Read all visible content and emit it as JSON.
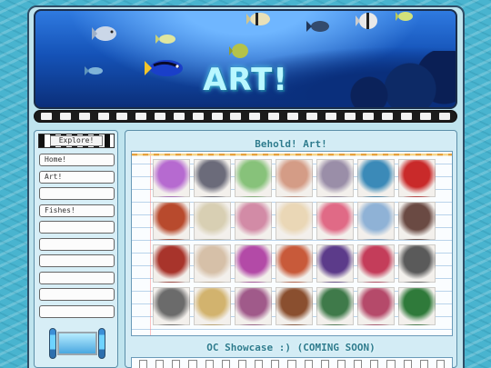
{
  "banner": {
    "title": "ART!"
  },
  "sidebar": {
    "header": "Explore!",
    "items": [
      {
        "label": "Home!"
      },
      {
        "label": "Art!"
      },
      {
        "label": ""
      },
      {
        "label": "Fishes!"
      },
      {
        "label": ""
      },
      {
        "label": ""
      },
      {
        "label": ""
      },
      {
        "label": ""
      },
      {
        "label": ""
      },
      {
        "label": ""
      }
    ]
  },
  "main": {
    "gallery_title": "Behold! Art!",
    "showcase_title": "OC Showcase :) (COMING SOON)"
  },
  "gallery": {
    "thumbnails": [
      "#b66ad0",
      "#6b6b7a",
      "#87c27a",
      "#d49c86",
      "#9a8ea8",
      "#3b8ab8",
      "#c92a2a",
      "#b84a2d",
      "#d8cfb3",
      "#d28ba6",
      "#ead7b6",
      "#e06a86",
      "#8fb2d6",
      "#6a4a43",
      "#a8342b",
      "#d6c0a8",
      "#b34aa7",
      "#c85a3a",
      "#5c3b8a",
      "#c43d5a",
      "#5a5a5a",
      "#6b6b6b",
      "#d2b36e",
      "#a05a8a",
      "#8a4f2f",
      "#3f7a4a",
      "#b54a6a",
      "#2f7a3a",
      "#e8d8e2"
    ]
  }
}
